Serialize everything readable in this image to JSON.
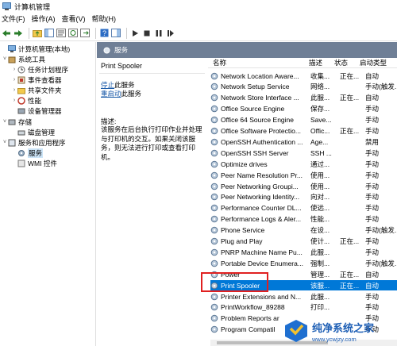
{
  "window": {
    "title": "计算机管理"
  },
  "menubar": [
    "文件(F)",
    "操作(A)",
    "查看(V)",
    "帮助(H)"
  ],
  "tree": [
    {
      "label": "计算机管理(本地)",
      "arrow": "",
      "icon": "computer-icon"
    },
    {
      "label": "系统工具",
      "arrow": "˅",
      "icon": "tools-icon"
    },
    {
      "label": "任务计划程序",
      "arrow": "›",
      "icon": "clock-icon"
    },
    {
      "label": "事件查看器",
      "arrow": "›",
      "icon": "event-icon"
    },
    {
      "label": "共享文件夹",
      "arrow": "›",
      "icon": "folder-icon"
    },
    {
      "label": "性能",
      "arrow": "›",
      "icon": "performance-icon"
    },
    {
      "label": "设备管理器",
      "arrow": "",
      "icon": "device-icon"
    },
    {
      "label": "存储",
      "arrow": "˅",
      "icon": "storage-icon"
    },
    {
      "label": "磁盘管理",
      "arrow": "",
      "icon": "disk-icon"
    },
    {
      "label": "服务和应用程序",
      "arrow": "˅",
      "icon": "apps-icon"
    },
    {
      "label": "服务",
      "arrow": "",
      "icon": "gear-icon"
    },
    {
      "label": "WMI 控件",
      "arrow": "",
      "icon": "wmi-icon"
    }
  ],
  "panel": {
    "header": "服务",
    "service_name": "Print Spooler",
    "stop_link": "停止",
    "stop_suffix": "此服务",
    "restart_link": "重启动",
    "restart_suffix": "此服务",
    "desc_label": "描述:",
    "description": "该服务在后台执行打印作业并处理与打印机的交互。如果关闭该服务，则无法进行打印或查看打印机。"
  },
  "columns": {
    "name": "名称",
    "desc": "描述",
    "status": "状态",
    "type": "启动类型"
  },
  "services": [
    {
      "name": "Network Location Aware...",
      "desc": "收集...",
      "status": "正在...",
      "type": "自动"
    },
    {
      "name": "Network Setup Service",
      "desc": "网络...",
      "status": "",
      "type": "手动(触发..."
    },
    {
      "name": "Network Store Interface ...",
      "desc": "此服...",
      "status": "正在...",
      "type": "自动"
    },
    {
      "name": "Office  Source Engine",
      "desc": "保存...",
      "status": "",
      "type": "手动"
    },
    {
      "name": "Office 64 Source Engine",
      "desc": "Save...",
      "status": "",
      "type": "手动"
    },
    {
      "name": "Office Software Protectio...",
      "desc": "Offic...",
      "status": "正在...",
      "type": "手动"
    },
    {
      "name": "OpenSSH Authentication ...",
      "desc": "Age...",
      "status": "",
      "type": "禁用"
    },
    {
      "name": "OpenSSH SSH Server",
      "desc": "SSH ...",
      "status": "",
      "type": "手动"
    },
    {
      "name": "Optimize drives",
      "desc": "通过...",
      "status": "",
      "type": "手动"
    },
    {
      "name": "Peer Name Resolution Pr...",
      "desc": "使用...",
      "status": "",
      "type": "手动"
    },
    {
      "name": "Peer Networking Groupi...",
      "desc": "使用...",
      "status": "",
      "type": "手动"
    },
    {
      "name": "Peer Networking Identity...",
      "desc": "向对...",
      "status": "",
      "type": "手动"
    },
    {
      "name": "Performance Counter DL...",
      "desc": "使远...",
      "status": "",
      "type": "手动"
    },
    {
      "name": "Performance Logs & Aler...",
      "desc": "性能...",
      "status": "",
      "type": "手动"
    },
    {
      "name": "Phone Service",
      "desc": "在设...",
      "status": "",
      "type": "手动(触发..."
    },
    {
      "name": "Plug and Play",
      "desc": "使计...",
      "status": "正在...",
      "type": "手动"
    },
    {
      "name": "PNRP Machine Name Pu...",
      "desc": "此服...",
      "status": "",
      "type": "手动"
    },
    {
      "name": "Portable Device Enumera...",
      "desc": "强制...",
      "status": "",
      "type": "手动(触发..."
    },
    {
      "name": "Power",
      "desc": "管理...",
      "status": "正在...",
      "type": "自动"
    },
    {
      "name": "Print Spooler",
      "desc": "该服...",
      "status": "正在...",
      "type": "自动"
    },
    {
      "name": "Printer Extensions and N...",
      "desc": "此服...",
      "status": "",
      "type": "手动"
    },
    {
      "name": "PrintWorkflow_89288",
      "desc": "打印...",
      "status": "",
      "type": "手动"
    },
    {
      "name": "Problem Reports ar",
      "desc": "",
      "status": "",
      "type": "手动"
    },
    {
      "name": "Program Compatil",
      "desc": "",
      "status": "",
      "type": "手动"
    }
  ],
  "selected_service_index": 19,
  "watermark": {
    "line1": "纯净系统之家",
    "line2": "www.ycwjzy.com"
  },
  "colors": {
    "selection": "#0078d7",
    "header": "#6f7f96",
    "link": "#1a5aa8",
    "highlight_box": "#e02020"
  }
}
